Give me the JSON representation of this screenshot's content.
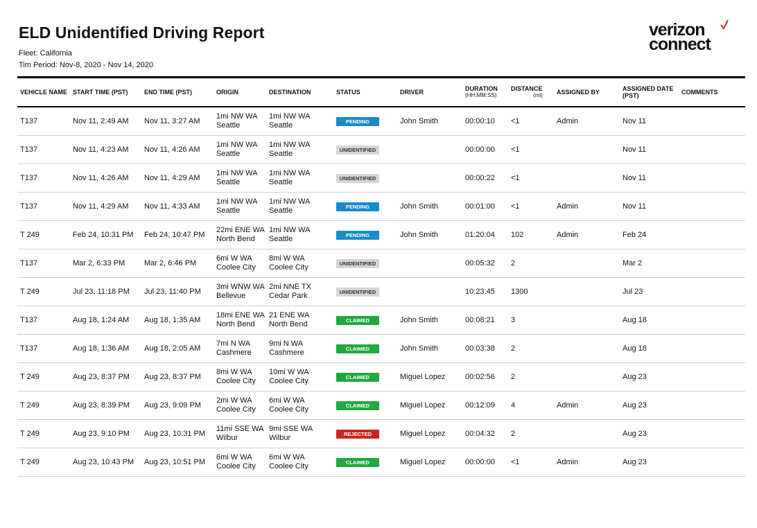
{
  "report": {
    "title": "ELD Unidentified Driving Report",
    "fleet": "Fleet: California",
    "period": "Tim Period: Nov-8, 2020 - Nov 14, 2020"
  },
  "logo": {
    "line1": "verizon",
    "line2": "connect",
    "mark": "check-icon",
    "mark_color": "#e4202e"
  },
  "status_colors": {
    "PENDING": "#1a8ac6",
    "UNIDENTIFIED": "#d4d4d4",
    "CLAIMED": "#21a83f",
    "REJECTED": "#c7291e"
  },
  "columns": {
    "vehicle": "VEHICLE NAME",
    "start": "START TIME (PST)",
    "end": "END TIME (PST)",
    "origin": "ORIGIN",
    "destination": "DESTINATION",
    "status": "STATUS",
    "driver": "DRIVER",
    "duration": "DURATION",
    "duration_sub": "(HH:MM:SS)",
    "distance": "DISTANCE",
    "distance_sub": "(mi)",
    "assigned_by": "ASSIGNED BY",
    "assigned_date": "ASSIGNED DATE (PST)",
    "comments": "COMMENTS"
  },
  "rows": [
    {
      "vehicle": "T137",
      "start": "Nov 11, 2:49 AM",
      "end": "Nov 11, 3:27 AM",
      "origin": [
        "1mi NW WA",
        "Seattle"
      ],
      "destination": [
        "1mi NW WA",
        "Seattle"
      ],
      "status": "PENDING",
      "driver": "John Smith",
      "duration": "00:00:10",
      "distance": "<1",
      "assigned_by": "Admin",
      "assigned_date": "Nov 11",
      "comments": ""
    },
    {
      "vehicle": "T137",
      "start": "Nov 11, 4:23 AM",
      "end": "Nov 11, 4:26 AM",
      "origin": [
        "1mi NW WA",
        "Seattle"
      ],
      "destination": [
        "1mi NW WA",
        "Seattle"
      ],
      "status": "UNIDENTIFIED",
      "driver": "",
      "duration": "00:00:00",
      "distance": "<1",
      "assigned_by": "",
      "assigned_date": "Nov 11",
      "comments": ""
    },
    {
      "vehicle": "T137",
      "start": "Nov 11, 4:26 AM",
      "end": "Nov 11, 4:29 AM",
      "origin": [
        "1mi NW WA",
        "Seattle"
      ],
      "destination": [
        "1mi NW WA",
        "Seattle"
      ],
      "status": "UNIDENTIFIED",
      "driver": "",
      "duration": "00:00:22",
      "distance": "<1",
      "assigned_by": "",
      "assigned_date": "Nov 11",
      "comments": ""
    },
    {
      "vehicle": "T137",
      "start": "Nov 11, 4:29 AM",
      "end": "Nov 11, 4:33 AM",
      "origin": [
        "1mi NW WA",
        "Seattle"
      ],
      "destination": [
        "1mi NW WA",
        "Seattle"
      ],
      "status": "PENDING",
      "driver": "John Smith",
      "duration": "00:01:00",
      "distance": "<1",
      "assigned_by": "Admin",
      "assigned_date": "Nov 11",
      "comments": ""
    },
    {
      "vehicle": "T 249",
      "start": "Feb 24, 10:31 PM",
      "end": "Feb 24, 10:47 PM",
      "origin": [
        "22mi ENE WA",
        "North Bend"
      ],
      "destination": [
        "1mi NW WA",
        "Seattle"
      ],
      "status": "PENDING",
      "driver": "John Smith",
      "duration": "01:20:04",
      "distance": "102",
      "assigned_by": "Admin",
      "assigned_date": "Feb 24",
      "comments": ""
    },
    {
      "vehicle": "T137",
      "start": "Mar 2, 6:33 PM",
      "end": "Mar 2, 6:46 PM",
      "origin": [
        "6mi W WA",
        "Coolee City"
      ],
      "destination": [
        "8mi W WA",
        "Coolee City"
      ],
      "status": "UNIDENTIFIED",
      "driver": "",
      "duration": "00:05:32",
      "distance": "2",
      "assigned_by": "",
      "assigned_date": "Mar 2",
      "comments": ""
    },
    {
      "vehicle": "T 249",
      "start": "Jul 23, 11:18 PM",
      "end": "Jul 23, 11:40 PM",
      "origin": [
        "3mi WNW WA",
        "Bellevue"
      ],
      "destination": [
        "2mi NNE TX",
        "Cedar Park"
      ],
      "status": "UNIDENTIFIED",
      "driver": "",
      "duration": "10:23:45",
      "distance": "1300",
      "assigned_by": "",
      "assigned_date": "Jul 23",
      "comments": ""
    },
    {
      "vehicle": "T137",
      "start": "Aug 18, 1:24 AM",
      "end": "Aug 18, 1:35 AM",
      "origin": [
        "18mi ENE WA",
        "North Bend"
      ],
      "destination": [
        "21 ENE WA",
        "North Bend"
      ],
      "status": "CLAIMED",
      "driver": "John Smith",
      "duration": "00:08:21",
      "distance": "3",
      "assigned_by": "",
      "assigned_date": "Aug 18",
      "comments": ""
    },
    {
      "vehicle": "T137",
      "start": "Aug 18, 1:36 AM",
      "end": "Aug 18, 2:05 AM",
      "origin": [
        "7mi N WA",
        "Cashmere"
      ],
      "destination": [
        "9mi N WA",
        "Cashmere"
      ],
      "status": "CLAIMED",
      "driver": "John Smith",
      "duration": "00:03:38",
      "distance": "2",
      "assigned_by": "",
      "assigned_date": "Aug 18",
      "comments": ""
    },
    {
      "vehicle": "T 249",
      "start": "Aug 23, 8:37 PM",
      "end": "Aug 23, 8:37 PM",
      "origin": [
        "8mi W WA",
        "Coolee City"
      ],
      "destination": [
        "10mi W WA",
        "Coolee City"
      ],
      "status": "CLAIMED",
      "driver": "Miguel Lopez",
      "duration": "00:02:56",
      "distance": "2",
      "assigned_by": "",
      "assigned_date": "Aug 23",
      "comments": ""
    },
    {
      "vehicle": "T 249",
      "start": "Aug 23, 8:39 PM",
      "end": "Aug 23, 9:09 PM",
      "origin": [
        "2mi W WA",
        "Coolee City"
      ],
      "destination": [
        "6mi W WA",
        "Coolee City"
      ],
      "status": "CLAIMED",
      "driver": "Miguel Lopez",
      "duration": "00:12:09",
      "distance": "4",
      "assigned_by": "Admin",
      "assigned_date": "Aug 23",
      "comments": ""
    },
    {
      "vehicle": "T 249",
      "start": "Aug 23, 9:10 PM",
      "end": "Aug 23, 10:31 PM",
      "origin": [
        "11mi SSE WA",
        "Wilbur"
      ],
      "destination": [
        "9mi SSE WA",
        "Wilbur"
      ],
      "status": "REJECTED",
      "driver": "Miguel Lopez",
      "duration": "00:04:32",
      "distance": "2",
      "assigned_by": "",
      "assigned_date": "Aug 23",
      "comments": ""
    },
    {
      "vehicle": "T 249",
      "start": "Aug 23, 10:43 PM",
      "end": "Aug 23, 10:51 PM",
      "origin": [
        "6mi W WA",
        "Coolee City"
      ],
      "destination": [
        "6mi W WA",
        "Coolee City"
      ],
      "status": "CLAIMED",
      "driver": "Miguel Lopez",
      "duration": "00:00:00",
      "distance": "<1",
      "assigned_by": "Admin",
      "assigned_date": "Aug 23",
      "comments": ""
    }
  ]
}
